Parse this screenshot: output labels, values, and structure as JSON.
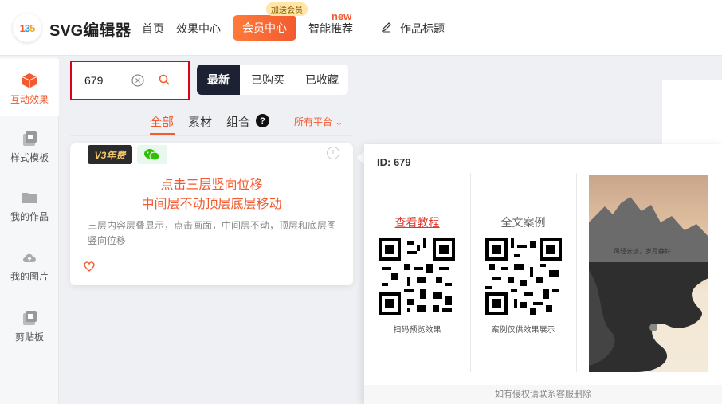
{
  "header": {
    "logo_text": "SVG编辑器",
    "nav": {
      "home": "首页",
      "effects": "效果中心",
      "member": "会员中心",
      "member_badge": "加送会员",
      "recommend": "智能推荐",
      "new_badge": "new",
      "title": "作品标题"
    }
  },
  "sidebar": {
    "items": [
      {
        "label": "互动效果",
        "icon": "cube-icon"
      },
      {
        "label": "样式模板",
        "icon": "template-icon"
      },
      {
        "label": "我的作品",
        "icon": "folder-icon"
      },
      {
        "label": "我的图片",
        "icon": "cloud-upload-icon"
      },
      {
        "label": "剪贴板",
        "icon": "clipboard-icon"
      }
    ]
  },
  "search": {
    "value": "679"
  },
  "segments": {
    "latest": "最新",
    "bought": "已购买",
    "fav": "已收藏"
  },
  "categories": {
    "all": "全部",
    "material": "素材",
    "combo": "组合",
    "help": "?",
    "platform": "所有平台"
  },
  "card": {
    "badge_v3": "V3年费",
    "title_line1": "点击三层竖向位移",
    "title_line2": "中间层不动顶层底层移动",
    "description": "三层内容层叠显示，点击画面，中间层不动，顶层和底层图竖向位移",
    "info": "!"
  },
  "popup": {
    "id_label": "ID: 679",
    "tutorial": "查看教程",
    "case": "全文案例",
    "qr_caption_1": "扫码预览效果",
    "qr_caption_2": "案例仅供效果展示",
    "poster_text": "风轻云淡，岁月静好",
    "footer": "如有侵权请联系客服删除"
  },
  "colors": {
    "accent": "#f25a2f",
    "dark": "#1c2233",
    "highlight": "#e0001b"
  }
}
